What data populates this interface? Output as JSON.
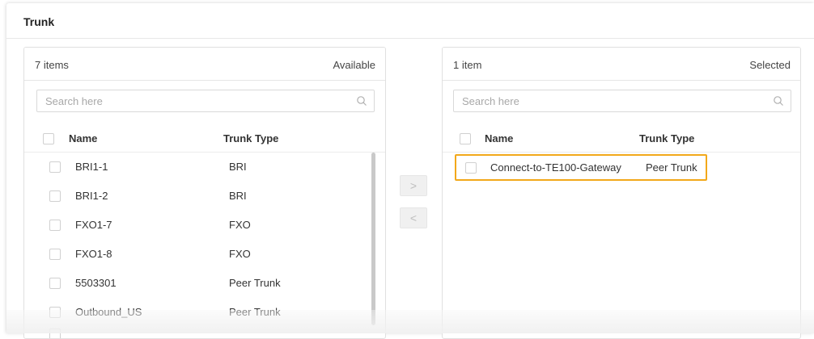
{
  "section": {
    "title": "Trunk"
  },
  "available": {
    "count_label": "7 items",
    "status_label": "Available",
    "search_placeholder": "Search here",
    "columns": {
      "name": "Name",
      "type": "Trunk Type"
    },
    "rows": [
      {
        "name": "BRI1-1",
        "type": "BRI"
      },
      {
        "name": "BRI1-2",
        "type": "BRI"
      },
      {
        "name": "FXO1-7",
        "type": "FXO"
      },
      {
        "name": "FXO1-8",
        "type": "FXO"
      },
      {
        "name": "5503301",
        "type": "Peer Trunk"
      },
      {
        "name": "Outbound_US",
        "type": "Peer Trunk"
      }
    ]
  },
  "selected": {
    "count_label": "1 item",
    "status_label": "Selected",
    "search_placeholder": "Search here",
    "columns": {
      "name": "Name",
      "type": "Trunk Type"
    },
    "rows": [
      {
        "name": "Connect-to-TE100-Gateway",
        "type": "Peer Trunk"
      }
    ]
  },
  "transfer": {
    "move_right_label": ">",
    "move_left_label": "<"
  },
  "icons": {
    "search": "search-icon"
  },
  "colors": {
    "highlight": "#f2a81a",
    "border": "#e0e0e0",
    "text": "#333333"
  }
}
